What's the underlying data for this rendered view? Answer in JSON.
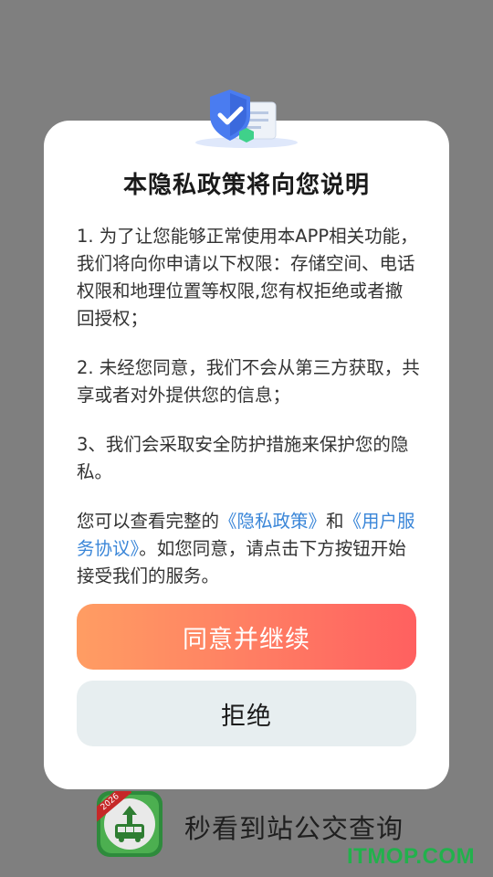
{
  "dialog": {
    "title": "本隐私政策将向您说明",
    "item1": "1. 为了让您能够正常使用本APP相关功能，我们将向你申请以下权限：存储空间、电话权限和地理位置等权限,您有权拒绝或者撤回授权；",
    "item2": "2. 未经您同意，我们不会从第三方获取，共享或者对外提供您的信息；",
    "item3": "3、我们会采取安全防护措施来保护您的隐私。",
    "info_prefix": "您可以查看完整的",
    "privacy_link": "《隐私政策》",
    "info_and": "和",
    "service_link": "《用户服务协议》",
    "info_suffix": "。如您同意，请点击下方按钮开始接受我们的服务。",
    "agree_label": "同意并继续",
    "reject_label": "拒绝"
  },
  "splash": {
    "app_name": "秒看到站公交查询",
    "icon_badge": "2026",
    "icon_name": "bus-app-icon"
  },
  "watermark": "ITMOP.COM",
  "colors": {
    "link": "#3a86d8",
    "agree_start": "#ff9d63",
    "agree_end": "#ff6060",
    "reject_bg": "#e7eef0"
  }
}
